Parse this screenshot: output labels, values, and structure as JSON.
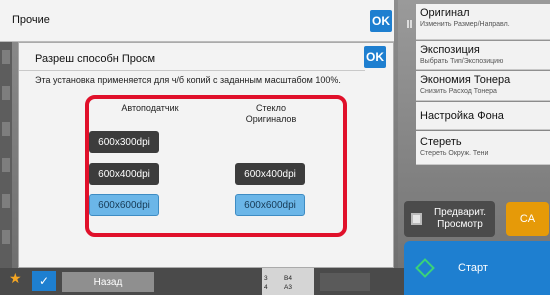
{
  "top_bar": {
    "title": "Прочие",
    "ok_label": "OK"
  },
  "dialog": {
    "title": "Разреш способн Просм",
    "ok_label": "OK",
    "message": "Эта установка применяется для ч/б копий с заданным масштабом 100%.",
    "columns": [
      {
        "header": "Автоподатчик",
        "options": [
          "600x300dpi",
          "600x400dpi",
          "600x600dpi"
        ],
        "selected": "600x600dpi"
      },
      {
        "header": "Стекло Оригиналов",
        "options": [
          "600x400dpi",
          "600x600dpi"
        ],
        "selected": "600x600dpi"
      }
    ]
  },
  "right_panel": {
    "items": [
      {
        "title": "Оригинал",
        "subtitle": "Изменить Размер/Направл."
      },
      {
        "title": "Экспозиция",
        "subtitle": "Выбрать Тип/Экспозицию"
      },
      {
        "title": "Экономия Тонера",
        "subtitle": "Снизить Расход Тонера"
      },
      {
        "title": "Настройка Фона",
        "subtitle": ""
      },
      {
        "title": "Стереть",
        "subtitle": "Стереть Окруж. Тени"
      }
    ],
    "preview_label": "Предварит. Просмотр",
    "ca_label": "CA",
    "start_label": "Старт"
  },
  "bottom_bar": {
    "back_label": "Назад",
    "paper": [
      {
        "num": "3",
        "size": "B4"
      },
      {
        "num": "4",
        "size": "A3"
      }
    ]
  },
  "colors": {
    "accent": "#1e7fd0",
    "highlight_frame": "#e0102a",
    "selected": "#6bb6e8",
    "ca": "#e69a08"
  }
}
